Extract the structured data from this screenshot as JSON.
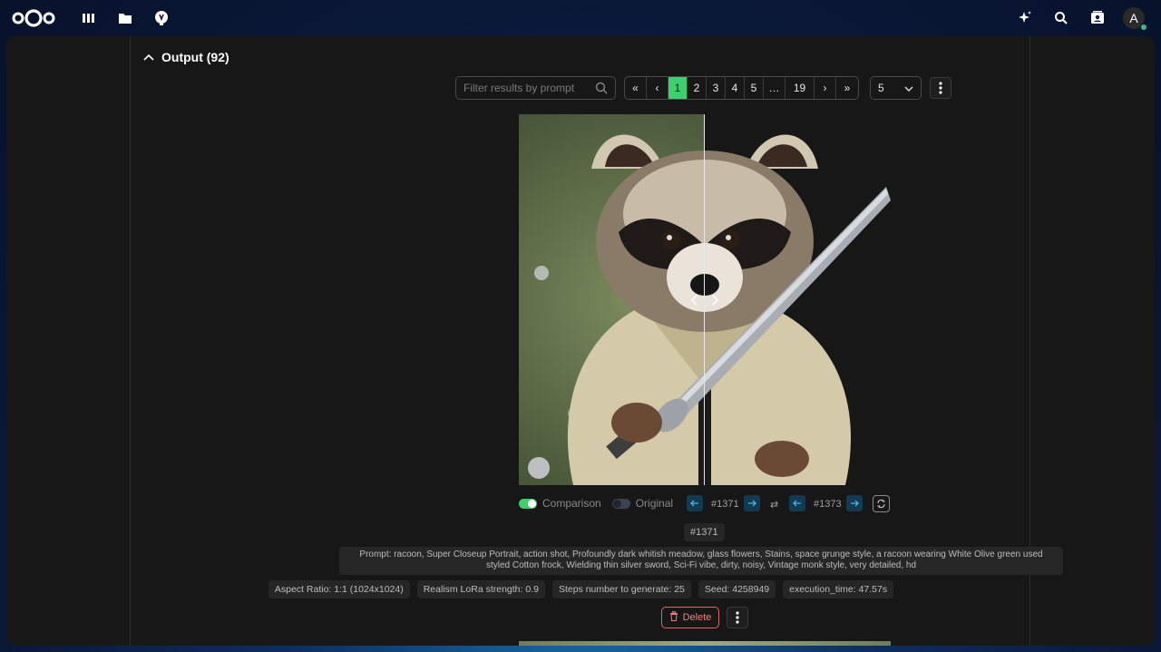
{
  "header": {
    "icons": [
      "nextcloud-logo",
      "dashboard-icon",
      "files-icon",
      "assistant-app-icon"
    ],
    "right_icons": [
      "ai-sparkle-icon",
      "search-icon",
      "contacts-icon"
    ],
    "avatar_letter": "A",
    "status_color": "#49b382"
  },
  "section": {
    "title": "Output (92)"
  },
  "filter": {
    "placeholder": "Filter results by prompt"
  },
  "pagination": {
    "first": "«",
    "prev": "‹",
    "pages": [
      "1",
      "2",
      "3",
      "4",
      "5"
    ],
    "active": "1",
    "ellipsis": "…",
    "last_page": "19",
    "next": "›",
    "last": "»",
    "per_page": "5"
  },
  "viewer": {
    "comparison_label": "Comparison",
    "original_label": "Original",
    "comparison_on": true,
    "left_id": "#1371",
    "right_id": "#1373",
    "swap_symbol": "⇄",
    "result_id": "#1371"
  },
  "result": {
    "prompt": "Prompt: racoon, Super Closeup Portrait, action shot, Profoundly dark whitish meadow, glass flowers, Stains, space grunge style, a racoon wearing White Olive green used styled Cotton frock, Wielding thin silver sword, Sci-Fi vibe, dirty, noisy, Vintage monk style, very detailed, hd",
    "params": [
      "Aspect Ratio: 1:1 (1024x1024)",
      "Realism LoRa strength: 0.9",
      "Steps number to generate: 25",
      "Seed: 4258949",
      "execution_time: 47.57s"
    ],
    "delete_label": "Delete"
  },
  "colors": {
    "accent": "#3ecf6f",
    "danger": "#e06666",
    "panel": "#171717"
  }
}
